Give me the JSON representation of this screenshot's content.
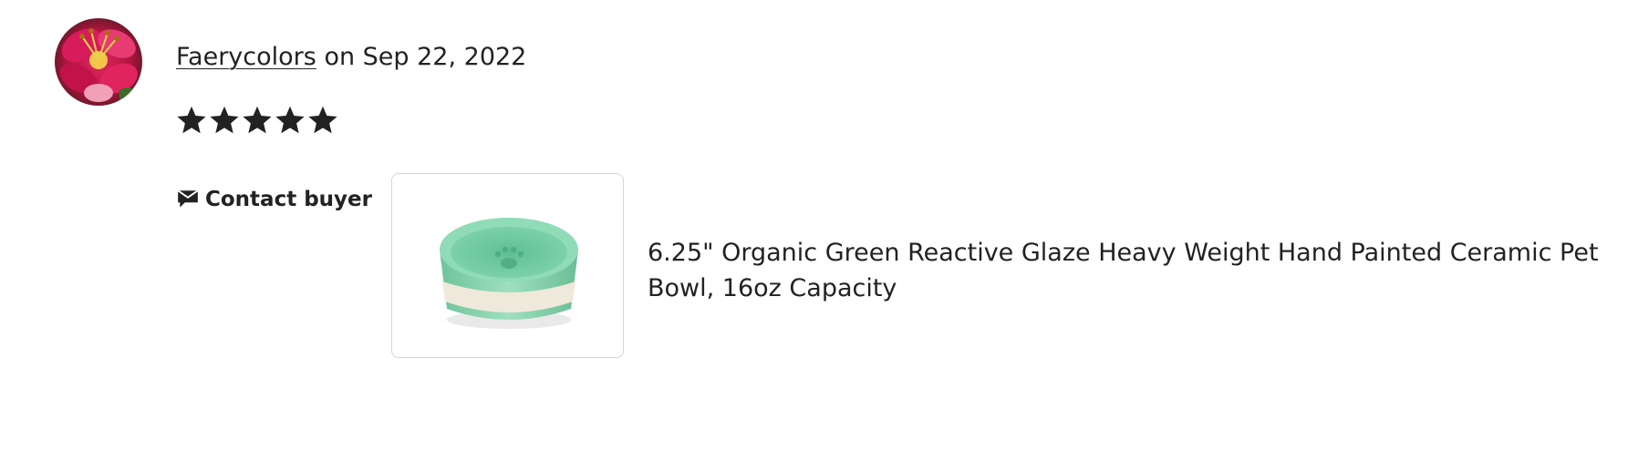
{
  "review": {
    "reviewer_name": "Faerycolors",
    "date_text": "on Sep 22, 2022",
    "rating": 5,
    "rating_max": 5,
    "contact_label": "Contact buyer"
  },
  "product": {
    "title": "6.25\" Organic Green Reactive Glaze Heavy Weight Hand Painted Ceramic Pet Bowl, 16oz Capacity"
  },
  "icons": {
    "avatar": "reviewer-avatar-flower",
    "star": "star-icon",
    "contact": "message-icon"
  },
  "colors": {
    "text": "#222222",
    "thumb_border": "#d6d6d6",
    "bowl_green": "#7fcfa8",
    "bowl_cream": "#efe9dc"
  }
}
